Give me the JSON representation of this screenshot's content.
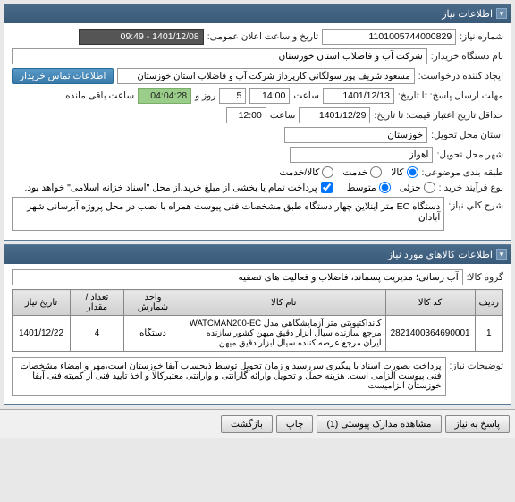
{
  "panel1": {
    "title": "اطلاعات نیاز",
    "need_no_label": "شماره نیاز:",
    "need_no": "1101005744000829",
    "announce_label": "تاریخ و ساعت اعلان عمومی:",
    "announce": "1401/12/08 - 09:49",
    "buyer_org_label": "نام دستگاه خریدار:",
    "buyer_org": "شرکت آب و فاضلاب استان خوزستان",
    "requester_label": "ایجاد کننده درخواست:",
    "requester": "مسعود شريف پور سولگاني کارپرداز شرکت آب و فاضلاب استان خوزستان",
    "contact_btn": "اطلاعات تماس خریدار",
    "reply_deadline_label": "مهلت ارسال پاسخ: تا تاریخ:",
    "reply_date": "1401/12/13",
    "hour_label": "ساعت",
    "reply_hour": "14:00",
    "day_label": "روز و",
    "day_val": "5",
    "remain_label": "ساعت باقی مانده",
    "remain_time": "04:04:28",
    "validity_label": "حداقل تاریخ اعتبار قیمت: تا تاریخ:",
    "validity_date": "1401/12/29",
    "validity_hour": "12:00",
    "province_label": "استان محل تحویل:",
    "province": "خوزستان",
    "city_label": "شهر محل تحویل:",
    "city": "اهواز",
    "category_label": "طبقه بندی موضوعی:",
    "cat_goods": "کالا",
    "cat_service": "خدمت",
    "cat_both": "کالا/خدمت",
    "purchase_type_label": "نوع فرآیند خرید :",
    "pt_partial": "جزئی",
    "pt_medium": "متوسط",
    "purchase_note": "پرداخت تمام یا بخشی از مبلغ خرید،از محل \"اسناد خزانه اسلامی\" خواهد بود.",
    "desc_label": "شرح کلي نیاز:",
    "desc": "دستگاه EC متر اینلاین چهار دستگاه  طبق مشخصات فنی پیوست همراه با نصب در محل پروژه آبرسانی شهر آبادان"
  },
  "panel2": {
    "title": "اطلاعات كالاهاي مورد نیاز",
    "goods_group_label": "گروه کالا:",
    "goods_group": "آب رسانی؛ مدیریت پسماند، فاضلاب و فعالیت های تصفیه",
    "table": {
      "headers": [
        "ردیف",
        "کد کالا",
        "نام کالا",
        "واحد شمارش",
        "تعداد / مقدار",
        "تاریخ نیاز"
      ],
      "rows": [
        {
          "idx": "1",
          "code": "2821400364690001",
          "name": "کانداکتیویتی متر آزمایشگاهی مدل WATCMAN200-EC مرجع سازنده سیال ابزار دقیق میهن کشور سازنده ایران مرجع عرضه کننده سیال ابزار دقیق میهن",
          "unit": "دستگاه",
          "qty": "4",
          "date": "1401/12/22"
        }
      ]
    },
    "notes_label": "توضیحات نیاز:",
    "notes": "پرداخت بصورت اسناد با پیگیری  سررسید و زمان تحویل توسط ذیحساب آبفا خوزستان است،مهر و امضاء مشخصات فنی پیوست الزامی است. هزینه حمل و تحویل وارائه گارانتی و وارانتی معتبرکالا و اخذ تایید فنی از کمیته فنی آبفا خوزستان الزامیست"
  },
  "footer": {
    "reply": "پاسخ به نیاز",
    "attachments": "مشاهده مدارک پیوستی (1)",
    "print": "چاپ",
    "back": "بازگشت"
  }
}
